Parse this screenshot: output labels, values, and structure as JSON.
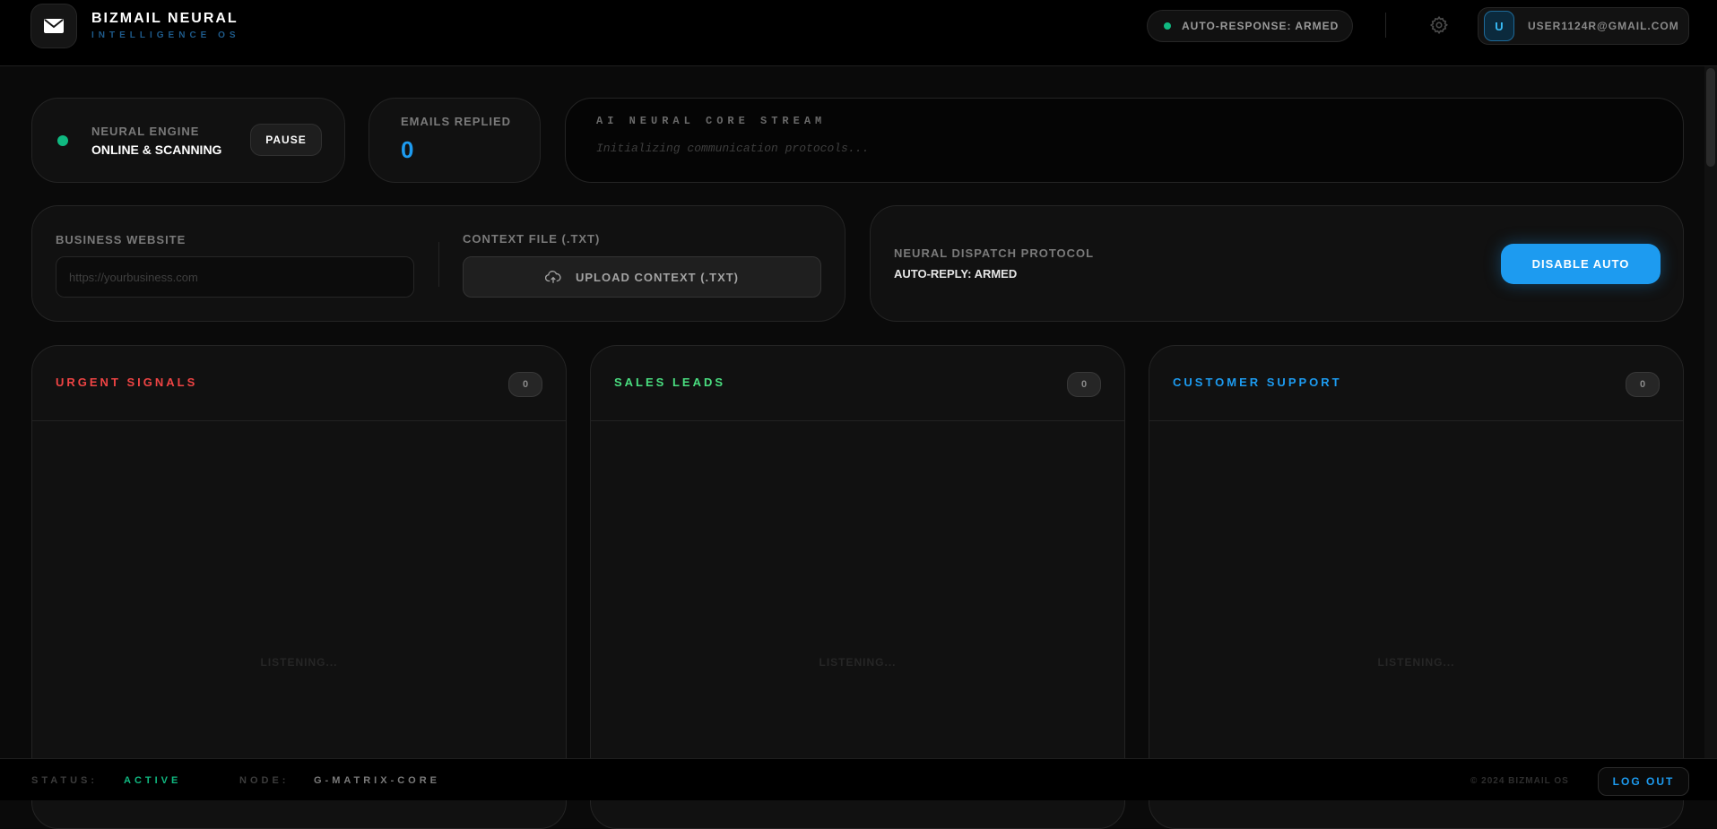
{
  "header": {
    "brand_title": "BIZMAIL NEURAL",
    "brand_subtitle": "INTELLIGENCE OS",
    "autoresponse_status": "AUTO-RESPONSE: ARMED",
    "user_initial": "U",
    "user_email": "USER1124R@GMAIL.COM"
  },
  "engine": {
    "label": "NEURAL ENGINE",
    "status": "ONLINE & SCANNING",
    "pause_label": "PAUSE"
  },
  "replied": {
    "label": "EMAILS REPLIED",
    "count": "0"
  },
  "stream": {
    "label": "AI NEURAL CORE STREAM",
    "message": "Initializing communication protocols..."
  },
  "config": {
    "website_label": "BUSINESS WEBSITE",
    "website_placeholder": "https://yourbusiness.com",
    "website_value": "",
    "context_label": "CONTEXT FILE (.TXT)",
    "upload_label": "UPLOAD CONTEXT (.TXT)"
  },
  "dispatch": {
    "label": "NEURAL DISPATCH PROTOCOL",
    "status": "AUTO-REPLY: ARMED",
    "button_label": "DISABLE AUTO"
  },
  "columns": [
    {
      "title": "URGENT SIGNALS",
      "count": "0",
      "color": "#ef4444",
      "empty": "LISTENING..."
    },
    {
      "title": "SALES LEADS",
      "count": "0",
      "color": "#4ade80",
      "empty": "LISTENING..."
    },
    {
      "title": "CUSTOMER SUPPORT",
      "count": "0",
      "color": "#1d9bf0",
      "empty": "LISTENING..."
    }
  ],
  "footer": {
    "status_label": "STATUS:",
    "status_value": "ACTIVE",
    "node_label": "NODE:",
    "node_value": "G-MATRIX-CORE",
    "copyright": "© 2024 BIZMAIL OS",
    "logout_label": "LOG OUT"
  },
  "colors": {
    "accent": "#1d9bf0",
    "online": "#10b981",
    "urgent": "#ef4444",
    "sales": "#4ade80"
  },
  "icons": {
    "logo": "mail-icon",
    "settings": "gear-icon",
    "upload": "cloud-upload-icon"
  }
}
